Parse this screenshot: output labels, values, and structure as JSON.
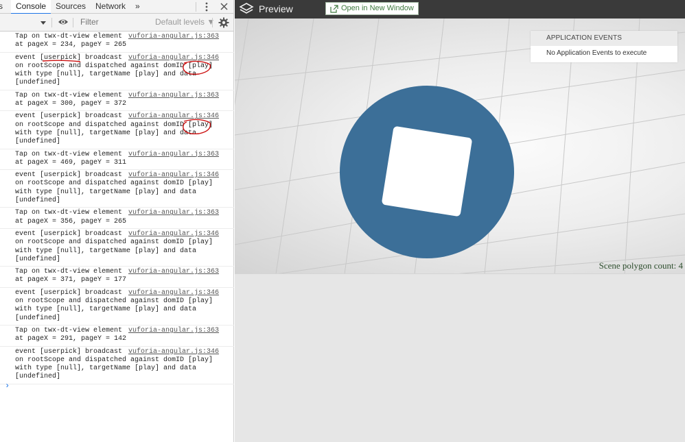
{
  "devtools": {
    "tabs": [
      {
        "label": "s"
      },
      {
        "label": "Console"
      },
      {
        "label": "Sources"
      },
      {
        "label": "Network"
      },
      {
        "label": "»"
      }
    ],
    "toolbar": {
      "context_selector_icon": "triangle-down-icon",
      "eye_icon": "eye-icon",
      "filter_placeholder": "Filter",
      "levels_label": "Default levels ▼",
      "settings_icon": "gear-icon"
    },
    "messages": [
      {
        "text": "Tap on twx-dt-view element\nat pageX = 234, pageY = 265",
        "source": "vuforia-angular.js:363"
      },
      {
        "text": "event [userpick] broadcast\non rootScope and dispatched against domID [play]\nwith type [null], targetName [play] and data\n[undefined]",
        "source": "vuforia-angular.js:346"
      },
      {
        "text": "Tap on twx-dt-view element\nat pageX = 300, pageY = 372",
        "source": "vuforia-angular.js:363"
      },
      {
        "text": "event [userpick] broadcast\non rootScope and dispatched against domID [play]\nwith type [null], targetName [play] and data\n[undefined]",
        "source": "vuforia-angular.js:346"
      },
      {
        "text": "Tap on twx-dt-view element\nat pageX = 469, pageY = 311",
        "source": "vuforia-angular.js:363"
      },
      {
        "text": "event [userpick] broadcast\non rootScope and dispatched against domID [play]\nwith type [null], targetName [play] and data\n[undefined]",
        "source": "vuforia-angular.js:346"
      },
      {
        "text": "Tap on twx-dt-view element\nat pageX = 356, pageY = 265",
        "source": "vuforia-angular.js:363"
      },
      {
        "text": "event [userpick] broadcast\non rootScope and dispatched against domID [play]\nwith type [null], targetName [play] and data\n[undefined]",
        "source": "vuforia-angular.js:346"
      },
      {
        "text": "Tap on twx-dt-view element\nat pageX = 371, pageY = 177",
        "source": "vuforia-angular.js:363"
      },
      {
        "text": "event [userpick] broadcast\non rootScope and dispatched against domID [play]\nwith type [null], targetName [play] and data\n[undefined]",
        "source": "vuforia-angular.js:346"
      },
      {
        "text": "Tap on twx-dt-view element\nat pageX = 291, pageY = 142",
        "source": "vuforia-angular.js:363"
      },
      {
        "text": "event [userpick] broadcast\non rootScope and dispatched against domID [play]\nwith type [null], targetName [play] and data\n[undefined]",
        "source": "vuforia-angular.js:346"
      }
    ],
    "prompt": "›"
  },
  "preview": {
    "title": "Preview",
    "open_window_label": "Open in New Window",
    "app_events": {
      "heading": "APPLICATION EVENTS",
      "empty_text": "No Application Events to execute"
    },
    "polygon_count": "Scene polygon count: 4"
  },
  "colors": {
    "header_bg": "#3a3a3a",
    "disc": "#3c6f98",
    "accent_tab": "#1a73e8",
    "annotation": "#cc1010"
  }
}
